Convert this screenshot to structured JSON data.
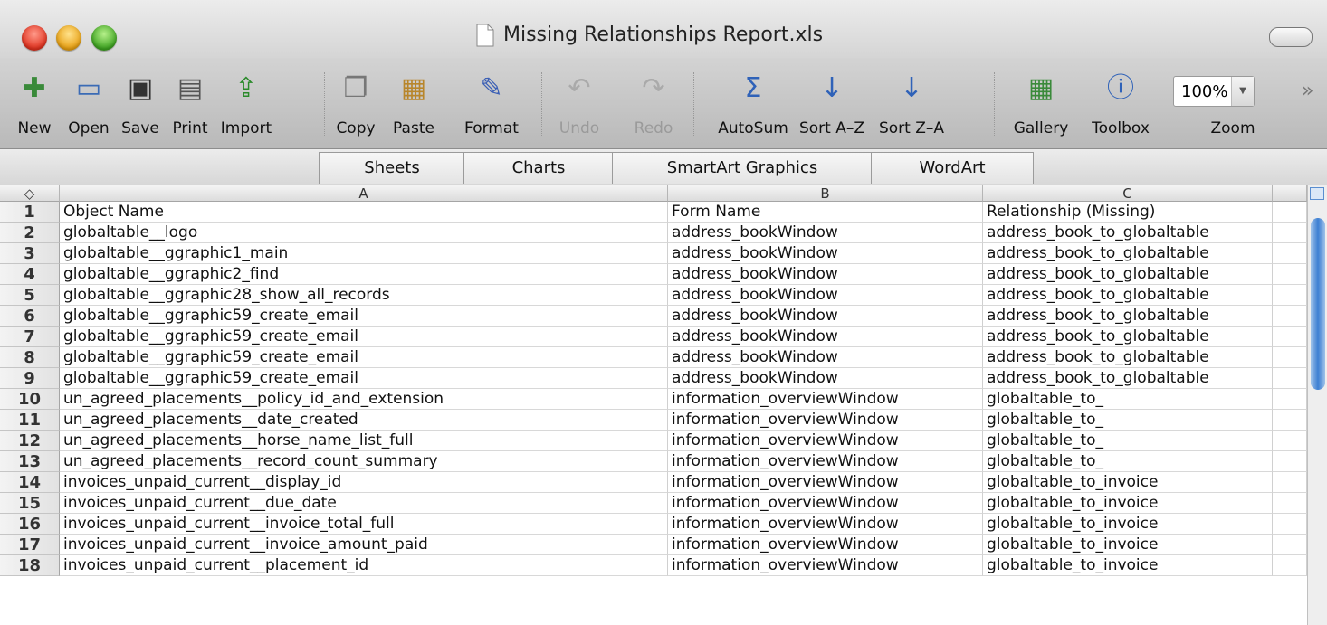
{
  "window": {
    "title": "Missing Relationships Report.xls"
  },
  "toolbar": {
    "buttons": [
      {
        "label": "New",
        "icon": "new-document-icon",
        "enabled": true
      },
      {
        "label": "Open",
        "icon": "open-folder-icon",
        "enabled": true
      },
      {
        "label": "Save",
        "icon": "save-disk-icon",
        "enabled": true
      },
      {
        "label": "Print",
        "icon": "printer-icon",
        "enabled": true
      },
      {
        "label": "Import",
        "icon": "import-icon",
        "enabled": true
      },
      {
        "label": "Copy",
        "icon": "copy-icon",
        "enabled": true
      },
      {
        "label": "Paste",
        "icon": "paste-icon",
        "enabled": true
      },
      {
        "label": "Format",
        "icon": "format-brush-icon",
        "enabled": true
      },
      {
        "label": "Undo",
        "icon": "undo-icon",
        "enabled": false
      },
      {
        "label": "Redo",
        "icon": "redo-icon",
        "enabled": false
      },
      {
        "label": "AutoSum",
        "icon": "sigma-icon",
        "enabled": true
      },
      {
        "label": "Sort A–Z",
        "icon": "sort-ascending-icon",
        "enabled": true
      },
      {
        "label": "Sort Z–A",
        "icon": "sort-descending-icon",
        "enabled": true
      },
      {
        "label": "Gallery",
        "icon": "gallery-icon",
        "enabled": true
      },
      {
        "label": "Toolbox",
        "icon": "toolbox-icon",
        "enabled": true
      }
    ],
    "zoom": {
      "label": "Zoom",
      "value": "100%"
    }
  },
  "ribbon": {
    "tabs": [
      "Sheets",
      "Charts",
      "SmartArt Graphics",
      "WordArt"
    ]
  },
  "sheet": {
    "columns": [
      "A",
      "B",
      "C"
    ],
    "rows": [
      {
        "n": "1",
        "a": "Object Name",
        "b": "Form Name",
        "c": "Relationship (Missing)"
      },
      {
        "n": "2",
        "a": "globaltable__logo",
        "b": "address_bookWindow",
        "c": "address_book_to_globaltable"
      },
      {
        "n": "3",
        "a": "globaltable__ggraphic1_main",
        "b": "address_bookWindow",
        "c": "address_book_to_globaltable"
      },
      {
        "n": "4",
        "a": "globaltable__ggraphic2_find",
        "b": "address_bookWindow",
        "c": "address_book_to_globaltable"
      },
      {
        "n": "5",
        "a": "globaltable__ggraphic28_show_all_records",
        "b": "address_bookWindow",
        "c": "address_book_to_globaltable"
      },
      {
        "n": "6",
        "a": "globaltable__ggraphic59_create_email",
        "b": "address_bookWindow",
        "c": "address_book_to_globaltable"
      },
      {
        "n": "7",
        "a": "globaltable__ggraphic59_create_email",
        "b": "address_bookWindow",
        "c": "address_book_to_globaltable"
      },
      {
        "n": "8",
        "a": "globaltable__ggraphic59_create_email",
        "b": "address_bookWindow",
        "c": "address_book_to_globaltable"
      },
      {
        "n": "9",
        "a": "globaltable__ggraphic59_create_email",
        "b": "address_bookWindow",
        "c": "address_book_to_globaltable"
      },
      {
        "n": "10",
        "a": "un_agreed_placements__policy_id_and_extension",
        "b": "information_overviewWindow",
        "c": "globaltable_to_"
      },
      {
        "n": "11",
        "a": "un_agreed_placements__date_created",
        "b": "information_overviewWindow",
        "c": "globaltable_to_"
      },
      {
        "n": "12",
        "a": "un_agreed_placements__horse_name_list_full",
        "b": "information_overviewWindow",
        "c": "globaltable_to_"
      },
      {
        "n": "13",
        "a": "un_agreed_placements__record_count_summary",
        "b": "information_overviewWindow",
        "c": "globaltable_to_"
      },
      {
        "n": "14",
        "a": "invoices_unpaid_current__display_id",
        "b": "information_overviewWindow",
        "c": "globaltable_to_invoice"
      },
      {
        "n": "15",
        "a": "invoices_unpaid_current__due_date",
        "b": "information_overviewWindow",
        "c": "globaltable_to_invoice"
      },
      {
        "n": "16",
        "a": "invoices_unpaid_current__invoice_total_full",
        "b": "information_overviewWindow",
        "c": "globaltable_to_invoice"
      },
      {
        "n": "17",
        "a": "invoices_unpaid_current__invoice_amount_paid",
        "b": "information_overviewWindow",
        "c": "globaltable_to_invoice"
      },
      {
        "n": "18",
        "a": "invoices_unpaid_current__placement_id",
        "b": "information_overviewWindow",
        "c": "globaltable_to_invoice"
      }
    ]
  }
}
